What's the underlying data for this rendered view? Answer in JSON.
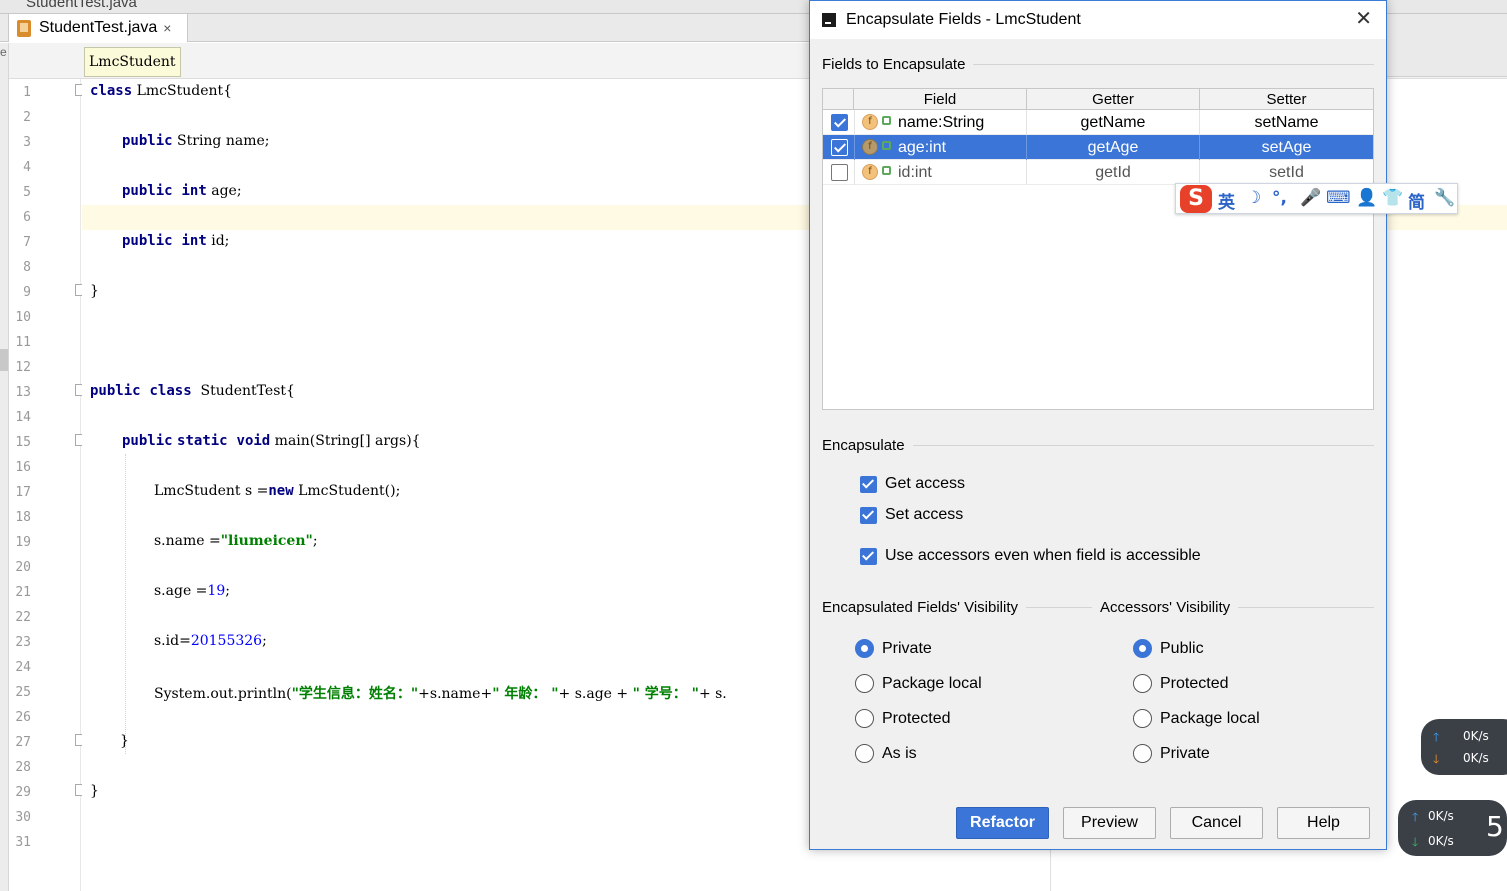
{
  "ide": {
    "top_tab_partial": "StudentTest.java",
    "tab": {
      "label": "StudentTest.java",
      "close": "×"
    },
    "breadcrumb": "LmcStudent",
    "left_edge_text": "e"
  },
  "editor": {
    "line_numbers": [
      "1",
      "2",
      "3",
      "4",
      "5",
      "6",
      "7",
      "8",
      "9",
      "10",
      "11",
      "12",
      "13",
      "14",
      "15",
      "16",
      "17",
      "18",
      "19",
      "20",
      "21",
      "22",
      "23",
      "24",
      "25",
      "26",
      "27",
      "28",
      "29",
      "30",
      "31"
    ],
    "code": {
      "l1_kw": "class",
      "l1_rest": " LmcStudent{",
      "l3_kw": "public",
      "l3_rest": " String name;",
      "l5_kw1": "public",
      "l5_kw2": "int",
      "l5_rest": " age;",
      "l7_kw1": "public",
      "l7_kw2": "int",
      "l7_rest": " id;",
      "l9": "}",
      "l13_kw1": "public",
      "l13_kw2": "class",
      "l13_rest": "  StudentTest{",
      "l15_kw1": "public",
      "l15_kw2": "static",
      "l15_kw3": "void",
      "l15_rest": " main(String[] args){",
      "l17_a": "LmcStudent s =",
      "l17_kw": "new",
      "l17_b": " LmcStudent();",
      "l19_a": "s.name =",
      "l19_str": "\"liumeicen\"",
      "l19_b": ";",
      "l21_a": "s.age =",
      "l21_num": "19",
      "l21_b": ";",
      "l23_a": "s.id=",
      "l23_num": "20155326",
      "l23_b": ";",
      "l25_a": "System.out.println(",
      "l25_s1": "\"学生信息：姓名：\"",
      "l25_b": "+s.name+",
      "l25_s2": "\" 年龄： \"",
      "l25_c": "+ s.age + ",
      "l25_s3": "\" 学号： \"",
      "l25_d": "+ s.",
      "l27": "}",
      "l29": "}"
    }
  },
  "dialog": {
    "title": "Encapsulate Fields - LmcStudent",
    "close": "✕",
    "fields_section": "Fields to Encapsulate",
    "columns": [
      "Field",
      "Getter",
      "Setter"
    ],
    "rows": [
      {
        "field": "name:String",
        "getter": "getName",
        "setter": "setName",
        "checked": true
      },
      {
        "field": "age:int",
        "getter": "getAge",
        "setter": "setAge",
        "checked": true
      },
      {
        "field": "id:int",
        "getter": "getId",
        "setter": "setId",
        "checked": false
      }
    ],
    "field_icon_letter": "f",
    "encapsulate_section": "Encapsulate",
    "get_access": "Get access",
    "set_access": "Set access",
    "use_accessors": "Use accessors even when field is accessible",
    "fields_visibility_section": "Encapsulated Fields' Visibility",
    "accessors_visibility_section": "Accessors' Visibility",
    "fields_visibility_options": [
      "Private",
      "Package local",
      "Protected",
      "As is"
    ],
    "fields_visibility_selected": "Private",
    "accessors_visibility_options": [
      "Public",
      "Protected",
      "Package local",
      "Private"
    ],
    "accessors_visibility_selected": "Public",
    "buttons": {
      "refactor": "Refactor",
      "preview": "Preview",
      "cancel": "Cancel",
      "help": "Help"
    }
  },
  "ime_toolbar": {
    "logo": "S",
    "items": [
      "英",
      "☽",
      "°,",
      "🎤",
      "⌨",
      "👤",
      "👕",
      "简",
      "🔧"
    ]
  },
  "speed_widget_1": {
    "up": "0K/s",
    "down": "0K/s"
  },
  "speed_widget_2": {
    "up": "0K/s",
    "down": "0K/s",
    "badge": "5"
  },
  "colors": {
    "accent": "#3b75d7",
    "keyword": "#000080",
    "string": "#008000",
    "number": "#0000ff",
    "current_line": "#fffae3"
  }
}
